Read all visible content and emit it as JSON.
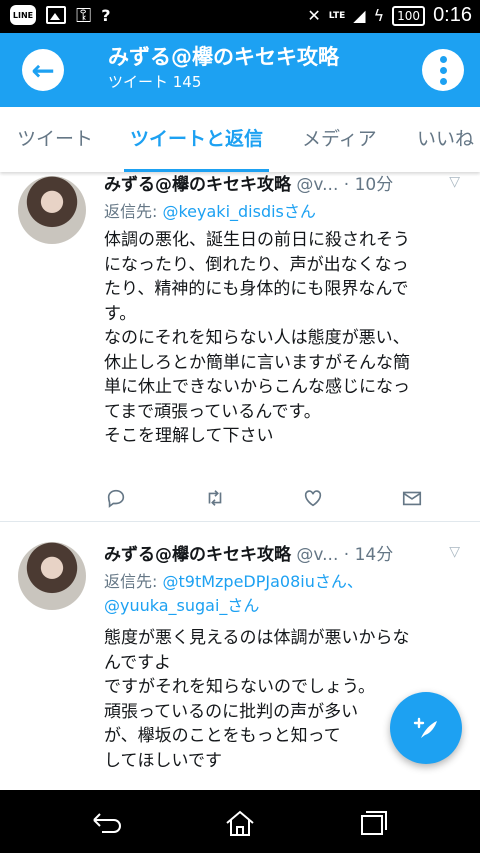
{
  "status_bar": {
    "line_label": "LINE",
    "lte_label": "LTE",
    "battery": "100",
    "time": "0:16"
  },
  "header": {
    "title": "みずる@欅のキセキ攻略",
    "subtitle": "ツイート 145"
  },
  "tabs": [
    {
      "label": "ツイート",
      "active": false
    },
    {
      "label": "ツイートと返信",
      "active": true
    },
    {
      "label": "メディア",
      "active": false
    },
    {
      "label": "いいね",
      "active": false
    }
  ],
  "tweets": [
    {
      "name": "みずる@欅のキセキ攻略",
      "handle": "@v...",
      "sep": "·",
      "time": "10分",
      "reply_prefix": "返信先: ",
      "reply_lines": [
        "@keyaki_disdisさん"
      ],
      "body_lines": [
        "体調の悪化、誕生日の前日に殺されそう",
        "になったり、倒れたり、声が出なくなっ",
        "たり、精神的にも身体的にも限界なんで",
        "す。",
        "なのにそれを知らない人は態度が悪い、",
        "休止しろとか簡単に言いますがそんな簡",
        "単に休止できないからこんな感じになっ",
        "てまで頑張っているんです。",
        "そこを理解して下さい"
      ]
    },
    {
      "name": "みずる@欅のキセキ攻略",
      "handle": "@v...",
      "sep": "·",
      "time": "14分",
      "reply_prefix": "返信先: ",
      "reply_lines": [
        "@t9tMzpeDPJa08iuさん、",
        "@yuuka_sugai_さん"
      ],
      "body_lines": [
        "態度が悪く見えるのは体調が悪いからな",
        "んですよ",
        "ですがそれを知らないのでしょう。",
        "頑張っているのに批判の声が多い",
        "が、欅坂のことをもっと知って",
        "してほしいです"
      ]
    }
  ],
  "colors": {
    "accent": "#1da1f2",
    "text": "#14171a",
    "muted": "#657786"
  },
  "icons": [
    "back-arrow-icon",
    "more-vertical-icon",
    "reply-icon",
    "retweet-icon",
    "like-icon",
    "message-icon",
    "compose-icon",
    "nav-back-icon",
    "nav-home-icon",
    "nav-recents-icon"
  ]
}
